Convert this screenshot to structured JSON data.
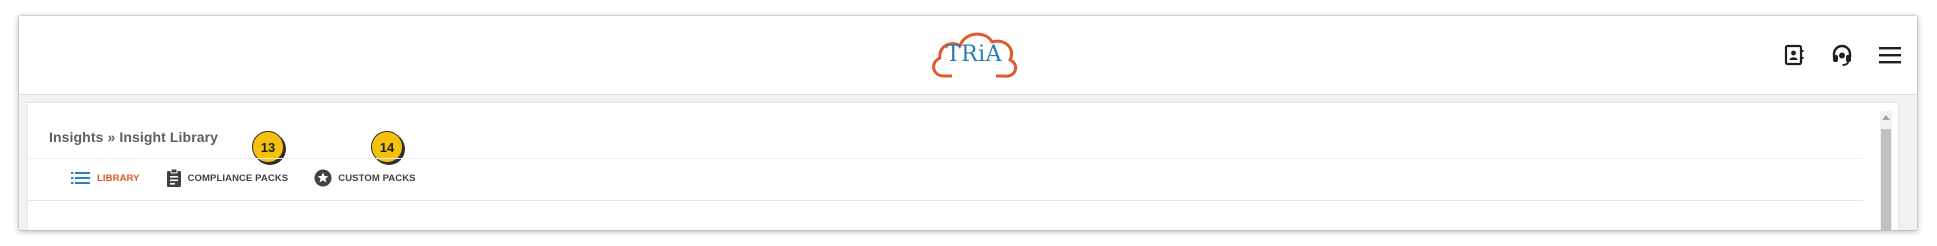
{
  "header": {
    "logo_text": "TRiA",
    "icons": [
      "contact-book-icon",
      "headset-icon",
      "hamburger-menu-icon"
    ],
    "brand_color": "#e05a2b"
  },
  "page": {
    "breadcrumb": "Insights » Insight Library",
    "badges": [
      "13",
      "14"
    ],
    "tabs": [
      {
        "label": "LIBRARY",
        "icon": "list-icon",
        "active": true
      },
      {
        "label": "COMPLIANCE PACKS",
        "icon": "clipboard-icon",
        "active": false
      },
      {
        "label": "CUSTOM PACKS",
        "icon": "star-circle-icon",
        "active": false
      }
    ],
    "active_tab_color": "#e05a2b",
    "badge_color": "#f4c20d"
  }
}
